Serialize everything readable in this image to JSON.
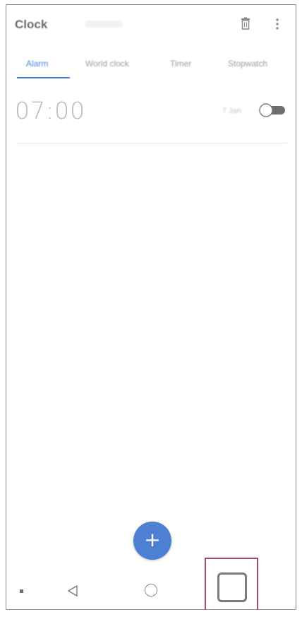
{
  "app_bar": {
    "title": "Clock",
    "icons": [
      "trash-icon",
      "more-vert-icon"
    ]
  },
  "tabs": [
    {
      "label": "Alarm",
      "active": true
    },
    {
      "label": "World clock",
      "active": false
    },
    {
      "label": "Timer",
      "active": false
    },
    {
      "label": "Stopwatch",
      "active": false
    }
  ],
  "alarm": {
    "time": "07:00",
    "days": "7 Jan",
    "enabled": false
  },
  "fab": {
    "label": "+",
    "icon": "add-icon"
  },
  "nav": {
    "icons": [
      "dot-icon",
      "back-icon",
      "home-icon",
      "recent-apps-icon"
    ]
  },
  "colors": {
    "accent": "#4a7fd4",
    "highlight_border": "#a0486e"
  }
}
